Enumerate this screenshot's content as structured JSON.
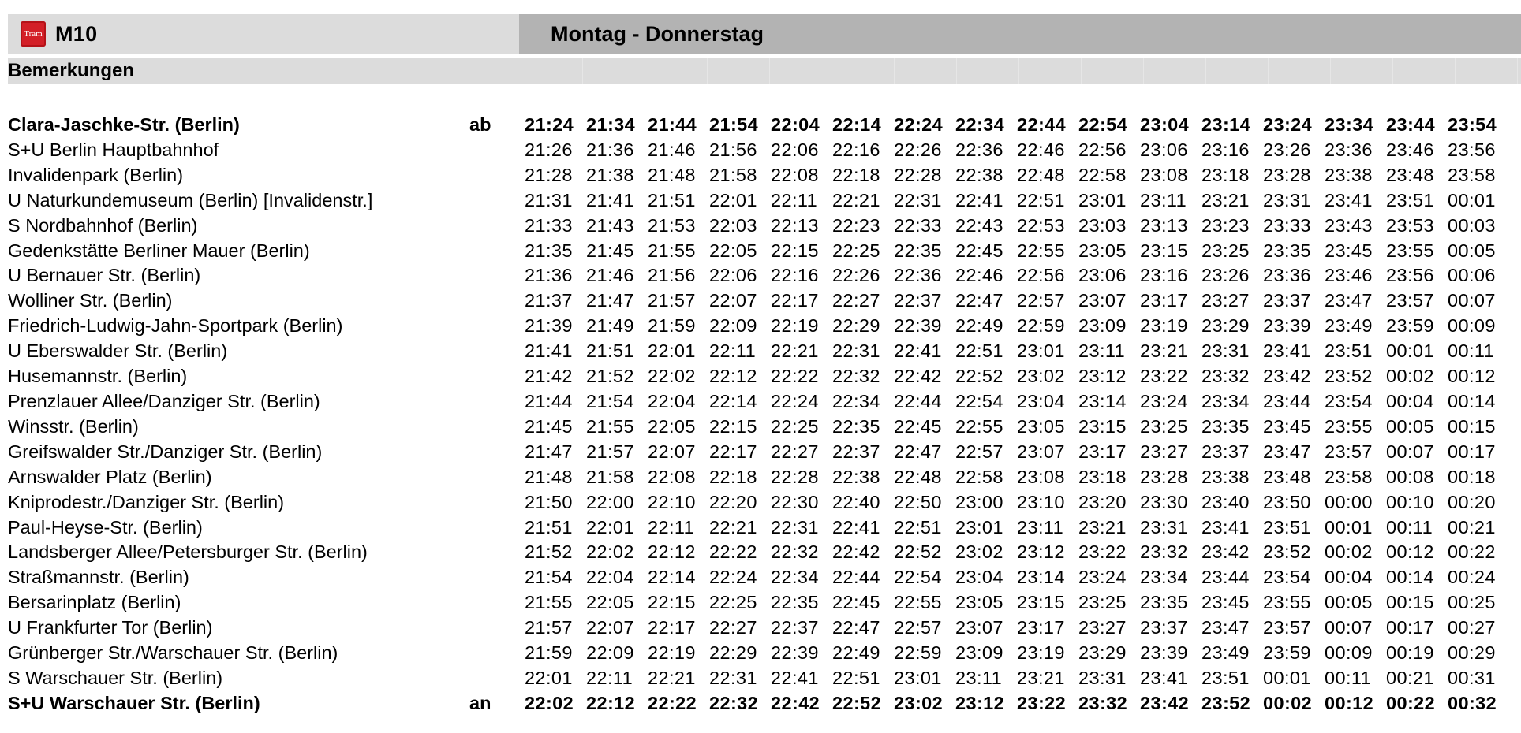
{
  "header": {
    "logo_text": "Tram",
    "line": "M10",
    "days": "Montag - Donnerstag"
  },
  "remarks_label": "Bemerkungen",
  "rows": [
    {
      "stop": "Clara-Jaschke-Str. (Berlin)",
      "marker": "ab",
      "bold": true,
      "times": [
        "21:24",
        "21:34",
        "21:44",
        "21:54",
        "22:04",
        "22:14",
        "22:24",
        "22:34",
        "22:44",
        "22:54",
        "23:04",
        "23:14",
        "23:24",
        "23:34",
        "23:44",
        "23:54"
      ]
    },
    {
      "stop": "S+U Berlin Hauptbahnhof",
      "marker": "",
      "bold": false,
      "times": [
        "21:26",
        "21:36",
        "21:46",
        "21:56",
        "22:06",
        "22:16",
        "22:26",
        "22:36",
        "22:46",
        "22:56",
        "23:06",
        "23:16",
        "23:26",
        "23:36",
        "23:46",
        "23:56"
      ]
    },
    {
      "stop": "Invalidenpark (Berlin)",
      "marker": "",
      "bold": false,
      "times": [
        "21:28",
        "21:38",
        "21:48",
        "21:58",
        "22:08",
        "22:18",
        "22:28",
        "22:38",
        "22:48",
        "22:58",
        "23:08",
        "23:18",
        "23:28",
        "23:38",
        "23:48",
        "23:58"
      ]
    },
    {
      "stop": "U Naturkundemuseum (Berlin) [Invalidenstr.]",
      "marker": "",
      "bold": false,
      "times": [
        "21:31",
        "21:41",
        "21:51",
        "22:01",
        "22:11",
        "22:21",
        "22:31",
        "22:41",
        "22:51",
        "23:01",
        "23:11",
        "23:21",
        "23:31",
        "23:41",
        "23:51",
        "00:01"
      ]
    },
    {
      "stop": "S Nordbahnhof (Berlin)",
      "marker": "",
      "bold": false,
      "times": [
        "21:33",
        "21:43",
        "21:53",
        "22:03",
        "22:13",
        "22:23",
        "22:33",
        "22:43",
        "22:53",
        "23:03",
        "23:13",
        "23:23",
        "23:33",
        "23:43",
        "23:53",
        "00:03"
      ]
    },
    {
      "stop": "Gedenkstätte Berliner Mauer (Berlin)",
      "marker": "",
      "bold": false,
      "times": [
        "21:35",
        "21:45",
        "21:55",
        "22:05",
        "22:15",
        "22:25",
        "22:35",
        "22:45",
        "22:55",
        "23:05",
        "23:15",
        "23:25",
        "23:35",
        "23:45",
        "23:55",
        "00:05"
      ]
    },
    {
      "stop": "U Bernauer Str. (Berlin)",
      "marker": "",
      "bold": false,
      "times": [
        "21:36",
        "21:46",
        "21:56",
        "22:06",
        "22:16",
        "22:26",
        "22:36",
        "22:46",
        "22:56",
        "23:06",
        "23:16",
        "23:26",
        "23:36",
        "23:46",
        "23:56",
        "00:06"
      ]
    },
    {
      "stop": "Wolliner Str. (Berlin)",
      "marker": "",
      "bold": false,
      "times": [
        "21:37",
        "21:47",
        "21:57",
        "22:07",
        "22:17",
        "22:27",
        "22:37",
        "22:47",
        "22:57",
        "23:07",
        "23:17",
        "23:27",
        "23:37",
        "23:47",
        "23:57",
        "00:07"
      ]
    },
    {
      "stop": "Friedrich-Ludwig-Jahn-Sportpark (Berlin)",
      "marker": "",
      "bold": false,
      "times": [
        "21:39",
        "21:49",
        "21:59",
        "22:09",
        "22:19",
        "22:29",
        "22:39",
        "22:49",
        "22:59",
        "23:09",
        "23:19",
        "23:29",
        "23:39",
        "23:49",
        "23:59",
        "00:09"
      ]
    },
    {
      "stop": "U Eberswalder Str. (Berlin)",
      "marker": "",
      "bold": false,
      "times": [
        "21:41",
        "21:51",
        "22:01",
        "22:11",
        "22:21",
        "22:31",
        "22:41",
        "22:51",
        "23:01",
        "23:11",
        "23:21",
        "23:31",
        "23:41",
        "23:51",
        "00:01",
        "00:11"
      ]
    },
    {
      "stop": "Husemannstr. (Berlin)",
      "marker": "",
      "bold": false,
      "times": [
        "21:42",
        "21:52",
        "22:02",
        "22:12",
        "22:22",
        "22:32",
        "22:42",
        "22:52",
        "23:02",
        "23:12",
        "23:22",
        "23:32",
        "23:42",
        "23:52",
        "00:02",
        "00:12"
      ]
    },
    {
      "stop": "Prenzlauer Allee/Danziger Str. (Berlin)",
      "marker": "",
      "bold": false,
      "times": [
        "21:44",
        "21:54",
        "22:04",
        "22:14",
        "22:24",
        "22:34",
        "22:44",
        "22:54",
        "23:04",
        "23:14",
        "23:24",
        "23:34",
        "23:44",
        "23:54",
        "00:04",
        "00:14"
      ]
    },
    {
      "stop": "Winsstr. (Berlin)",
      "marker": "",
      "bold": false,
      "times": [
        "21:45",
        "21:55",
        "22:05",
        "22:15",
        "22:25",
        "22:35",
        "22:45",
        "22:55",
        "23:05",
        "23:15",
        "23:25",
        "23:35",
        "23:45",
        "23:55",
        "00:05",
        "00:15"
      ]
    },
    {
      "stop": "Greifswalder Str./Danziger Str. (Berlin)",
      "marker": "",
      "bold": false,
      "times": [
        "21:47",
        "21:57",
        "22:07",
        "22:17",
        "22:27",
        "22:37",
        "22:47",
        "22:57",
        "23:07",
        "23:17",
        "23:27",
        "23:37",
        "23:47",
        "23:57",
        "00:07",
        "00:17"
      ]
    },
    {
      "stop": "Arnswalder Platz (Berlin)",
      "marker": "",
      "bold": false,
      "times": [
        "21:48",
        "21:58",
        "22:08",
        "22:18",
        "22:28",
        "22:38",
        "22:48",
        "22:58",
        "23:08",
        "23:18",
        "23:28",
        "23:38",
        "23:48",
        "23:58",
        "00:08",
        "00:18"
      ]
    },
    {
      "stop": "Kniprodestr./Danziger Str. (Berlin)",
      "marker": "",
      "bold": false,
      "times": [
        "21:50",
        "22:00",
        "22:10",
        "22:20",
        "22:30",
        "22:40",
        "22:50",
        "23:00",
        "23:10",
        "23:20",
        "23:30",
        "23:40",
        "23:50",
        "00:00",
        "00:10",
        "00:20"
      ]
    },
    {
      "stop": "Paul-Heyse-Str. (Berlin)",
      "marker": "",
      "bold": false,
      "times": [
        "21:51",
        "22:01",
        "22:11",
        "22:21",
        "22:31",
        "22:41",
        "22:51",
        "23:01",
        "23:11",
        "23:21",
        "23:31",
        "23:41",
        "23:51",
        "00:01",
        "00:11",
        "00:21"
      ]
    },
    {
      "stop": "Landsberger Allee/Petersburger Str. (Berlin)",
      "marker": "",
      "bold": false,
      "times": [
        "21:52",
        "22:02",
        "22:12",
        "22:22",
        "22:32",
        "22:42",
        "22:52",
        "23:02",
        "23:12",
        "23:22",
        "23:32",
        "23:42",
        "23:52",
        "00:02",
        "00:12",
        "00:22"
      ]
    },
    {
      "stop": "Straßmannstr. (Berlin)",
      "marker": "",
      "bold": false,
      "times": [
        "21:54",
        "22:04",
        "22:14",
        "22:24",
        "22:34",
        "22:44",
        "22:54",
        "23:04",
        "23:14",
        "23:24",
        "23:34",
        "23:44",
        "23:54",
        "00:04",
        "00:14",
        "00:24"
      ]
    },
    {
      "stop": "Bersarinplatz (Berlin)",
      "marker": "",
      "bold": false,
      "times": [
        "21:55",
        "22:05",
        "22:15",
        "22:25",
        "22:35",
        "22:45",
        "22:55",
        "23:05",
        "23:15",
        "23:25",
        "23:35",
        "23:45",
        "23:55",
        "00:05",
        "00:15",
        "00:25"
      ]
    },
    {
      "stop": "U Frankfurter Tor (Berlin)",
      "marker": "",
      "bold": false,
      "times": [
        "21:57",
        "22:07",
        "22:17",
        "22:27",
        "22:37",
        "22:47",
        "22:57",
        "23:07",
        "23:17",
        "23:27",
        "23:37",
        "23:47",
        "23:57",
        "00:07",
        "00:17",
        "00:27"
      ]
    },
    {
      "stop": "Grünberger Str./Warschauer Str. (Berlin)",
      "marker": "",
      "bold": false,
      "times": [
        "21:59",
        "22:09",
        "22:19",
        "22:29",
        "22:39",
        "22:49",
        "22:59",
        "23:09",
        "23:19",
        "23:29",
        "23:39",
        "23:49",
        "23:59",
        "00:09",
        "00:19",
        "00:29"
      ]
    },
    {
      "stop": "S Warschauer Str. (Berlin)",
      "marker": "",
      "bold": false,
      "times": [
        "22:01",
        "22:11",
        "22:21",
        "22:31",
        "22:41",
        "22:51",
        "23:01",
        "23:11",
        "23:21",
        "23:31",
        "23:41",
        "23:51",
        "00:01",
        "00:11",
        "00:21",
        "00:31"
      ]
    },
    {
      "stop": "S+U Warschauer Str. (Berlin)",
      "marker": "an",
      "bold": true,
      "times": [
        "22:02",
        "22:12",
        "22:22",
        "22:32",
        "22:42",
        "22:52",
        "23:02",
        "23:12",
        "23:22",
        "23:32",
        "23:42",
        "23:52",
        "00:02",
        "00:12",
        "00:22",
        "00:32"
      ]
    }
  ],
  "colors": {
    "logo_red": "#d31f27",
    "header_light": "#dcdcdc",
    "header_dark": "#b3b3b3"
  },
  "icons": {
    "logo": "tram-logo-icon"
  }
}
